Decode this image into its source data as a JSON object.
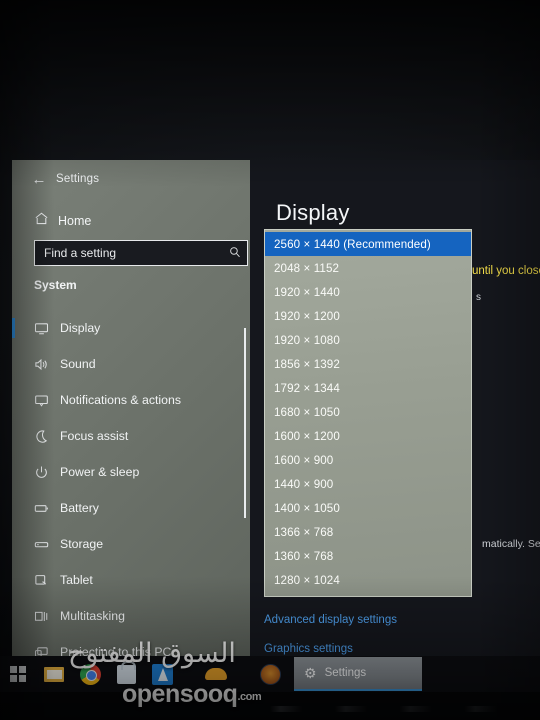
{
  "window": {
    "title": "Settings",
    "back_icon": "back-arrow-icon"
  },
  "sidebar": {
    "home": {
      "label": "Home",
      "icon": "home-icon"
    },
    "search": {
      "placeholder": "Find a setting",
      "icon": "search-icon"
    },
    "section_label": "System",
    "items": [
      {
        "label": "Display",
        "icon": "monitor-icon",
        "selected": true
      },
      {
        "label": "Sound",
        "icon": "speaker-icon",
        "selected": false
      },
      {
        "label": "Notifications & actions",
        "icon": "notification-icon",
        "selected": false
      },
      {
        "label": "Focus assist",
        "icon": "moon-icon",
        "selected": false
      },
      {
        "label": "Power & sleep",
        "icon": "power-icon",
        "selected": false
      },
      {
        "label": "Battery",
        "icon": "battery-icon",
        "selected": false
      },
      {
        "label": "Storage",
        "icon": "storage-icon",
        "selected": false
      },
      {
        "label": "Tablet",
        "icon": "tablet-icon",
        "selected": false
      },
      {
        "label": "Multitasking",
        "icon": "multitasking-icon",
        "selected": false
      },
      {
        "label": "Projecting to this PC",
        "icon": "projecting-icon",
        "selected": false
      }
    ]
  },
  "main": {
    "page_title": "Display",
    "warning_text": "until you close",
    "ghost_text": "s",
    "body_text": "matically. Selec",
    "links": [
      {
        "label": "Advanced display settings"
      },
      {
        "label": "Graphics settings"
      }
    ]
  },
  "resolution_dropdown": {
    "selected": "2560 × 1440 (Recommended)",
    "options": [
      "2560 × 1440 (Recommended)",
      "2048 × 1152",
      "1920 × 1440",
      "1920 × 1200",
      "1920 × 1080",
      "1856 × 1392",
      "1792 × 1344",
      "1680 × 1050",
      "1600 × 1200",
      "1600 × 900",
      "1440 × 900",
      "1400 × 1050",
      "1366 × 768",
      "1360 × 768",
      "1280 × 1024"
    ]
  },
  "taskbar": {
    "items": [
      {
        "name": "start-button",
        "icon": "windows-logo-icon"
      },
      {
        "name": "file-explorer",
        "icon": "folder-icon"
      },
      {
        "name": "google-chrome",
        "icon": "chrome-icon"
      },
      {
        "name": "microsoft-store",
        "icon": "store-icon"
      },
      {
        "name": "blue-app",
        "icon": "blue-app-icon"
      },
      {
        "name": "cloud-app",
        "icon": "cloud-icon"
      },
      {
        "name": "circle-app",
        "icon": "circle-app-icon"
      }
    ],
    "active": {
      "label": "Settings",
      "icon": "gear-icon"
    }
  },
  "watermark": {
    "arabic": "السوق المفتوح",
    "latin": "opensooq",
    "domain": ".com"
  },
  "colors": {
    "accent_blue": "#1564c0",
    "link_blue": "#4ea0ee",
    "warning_yellow": "#f6e04a",
    "sidebar_bg": "#6b7169",
    "popup_bg": "#989e92",
    "desktop_bg": "#13151b"
  }
}
